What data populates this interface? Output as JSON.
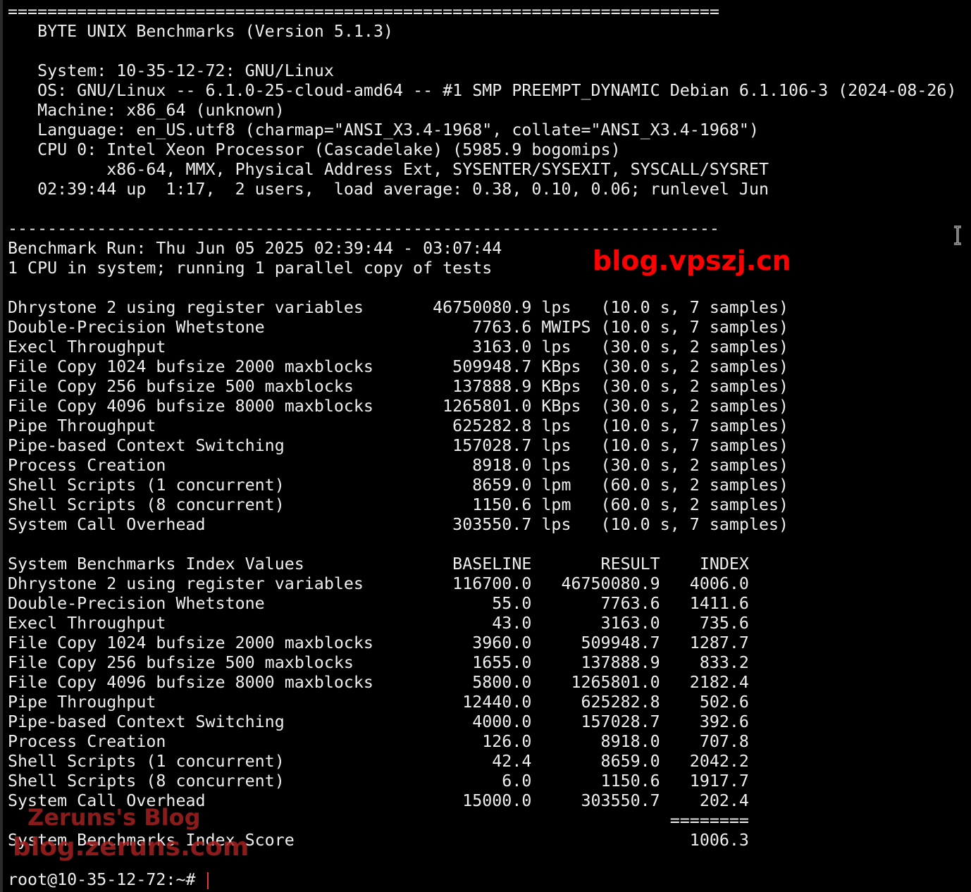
{
  "terminal": {
    "lines": [
      "========================================================================",
      "   BYTE UNIX Benchmarks (Version 5.1.3)",
      "",
      "   System: 10-35-12-72: GNU/Linux",
      "   OS: GNU/Linux -- 6.1.0-25-cloud-amd64 -- #1 SMP PREEMPT_DYNAMIC Debian 6.1.106-3 (2024-08-26)",
      "   Machine: x86_64 (unknown)",
      "   Language: en_US.utf8 (charmap=\"ANSI_X3.4-1968\", collate=\"ANSI_X3.4-1968\")",
      "   CPU 0: Intel Xeon Processor (Cascadelake) (5985.9 bogomips)",
      "          x86-64, MMX, Physical Address Ext, SYSENTER/SYSEXIT, SYSCALL/SYSRET",
      "   02:39:44 up  1:17,  2 users,  load average: 0.38, 0.10, 0.06; runlevel Jun",
      "",
      "------------------------------------------------------------------------",
      "Benchmark Run: Thu Jun 05 2025 02:39:44 - 03:07:44",
      "1 CPU in system; running 1 parallel copy of tests",
      "",
      "Dhrystone 2 using register variables       46750080.9 lps   (10.0 s, 7 samples)",
      "Double-Precision Whetstone                     7763.6 MWIPS (10.0 s, 7 samples)",
      "Execl Throughput                               3163.0 lps   (30.0 s, 2 samples)",
      "File Copy 1024 bufsize 2000 maxblocks        509948.7 KBps  (30.0 s, 2 samples)",
      "File Copy 256 bufsize 500 maxblocks          137888.9 KBps  (30.0 s, 2 samples)",
      "File Copy 4096 bufsize 8000 maxblocks       1265801.0 KBps  (30.0 s, 2 samples)",
      "Pipe Throughput                              625282.8 lps   (10.0 s, 7 samples)",
      "Pipe-based Context Switching                 157028.7 lps   (10.0 s, 7 samples)",
      "Process Creation                               8918.0 lps   (30.0 s, 2 samples)",
      "Shell Scripts (1 concurrent)                   8659.0 lpm   (60.0 s, 2 samples)",
      "Shell Scripts (8 concurrent)                   1150.6 lpm   (60.0 s, 2 samples)",
      "System Call Overhead                         303550.7 lps   (10.0 s, 7 samples)",
      "",
      "System Benchmarks Index Values               BASELINE       RESULT    INDEX",
      "Dhrystone 2 using register variables         116700.0   46750080.9   4006.0",
      "Double-Precision Whetstone                       55.0       7763.6   1411.6",
      "Execl Throughput                                 43.0       3163.0    735.6",
      "File Copy 1024 bufsize 2000 maxblocks          3960.0     509948.7   1287.7",
      "File Copy 256 bufsize 500 maxblocks            1655.0     137888.9    833.2",
      "File Copy 4096 bufsize 8000 maxblocks          5800.0    1265801.0   2182.4",
      "Pipe Throughput                               12440.0     625282.8    502.6",
      "Pipe-based Context Switching                   4000.0     157028.7    392.6",
      "Process Creation                                126.0       8918.0    707.8",
      "Shell Scripts (1 concurrent)                     42.4       8659.0   2042.2",
      "Shell Scripts (8 concurrent)                      6.0       1150.6   1917.7",
      "System Call Overhead                          15000.0     303550.7    202.4",
      "                                                                   ========",
      "System Benchmarks Index Score                                        1006.3",
      "",
      "root@10-35-12-72:~# "
    ]
  },
  "watermarks": {
    "vpszj": "blog.vpszj.cn",
    "zeruns_title": "Zeruns's Blog",
    "zeruns_url": "blog.zeruns.com"
  },
  "colors": {
    "background": "#000000",
    "text": "#eeeeee",
    "watermark_red": "#ff0000",
    "watermark_dark_red": "#a52020",
    "cursor": "#e53935"
  },
  "icons": {
    "mouse_pointer": "text-ibeam-cursor-icon"
  }
}
